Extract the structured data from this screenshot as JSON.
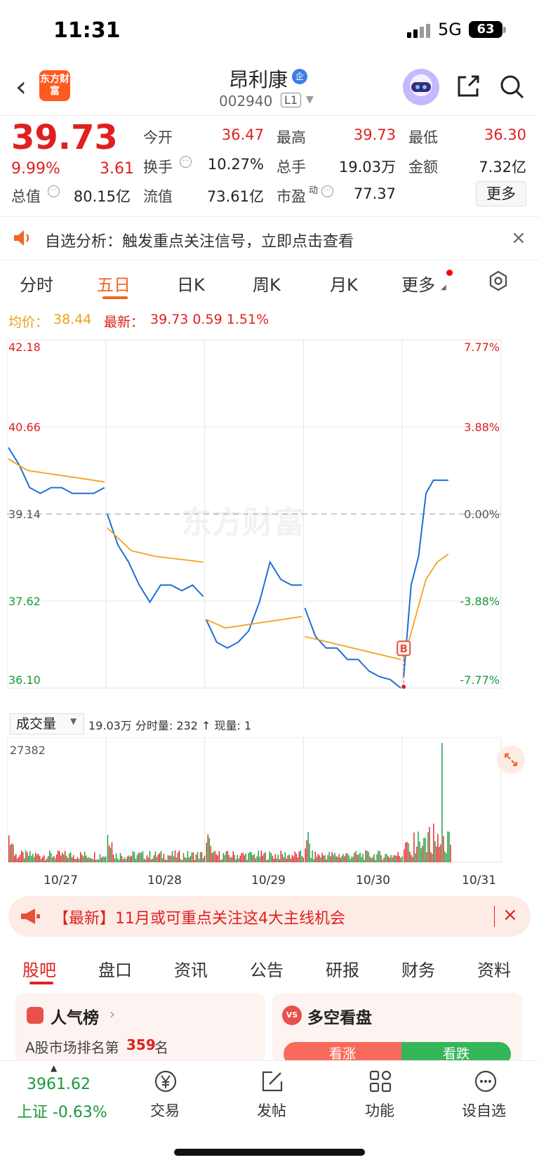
{
  "status_bar": {
    "time": "11:31",
    "network": "5G",
    "battery": "63"
  },
  "header": {
    "name": "昂利康",
    "name_badge": "企",
    "code": "002940",
    "market_tag": "L1",
    "logo_text": "东方财富"
  },
  "quote": {
    "price": "39.73",
    "change_pct": "9.99%",
    "change": "3.61",
    "fields": [
      {
        "label": "今开",
        "value": "36.47",
        "color": "red"
      },
      {
        "label": "最高",
        "value": "39.73",
        "color": "red"
      },
      {
        "label": "最低",
        "value": "36.30",
        "color": "red"
      },
      {
        "label": "换手",
        "value": "10.27%",
        "color": "dark"
      },
      {
        "label": "总手",
        "value": "19.03万",
        "color": "dark"
      },
      {
        "label": "金额",
        "value": "7.32亿",
        "color": "dark"
      },
      {
        "label": "总值",
        "value": "80.15亿",
        "color": "dark"
      },
      {
        "label": "流值",
        "value": "73.61亿",
        "color": "dark"
      },
      {
        "label": "市盈",
        "label_sup": "动",
        "value": "77.37",
        "color": "dark"
      }
    ],
    "more_label": "更多"
  },
  "alert": {
    "text": "自选分析：触发重点关注信号，立即点击查看",
    "close": "×"
  },
  "chart_tabs": [
    "分时",
    "五日",
    "日K",
    "周K",
    "月K",
    "更多"
  ],
  "active_chart_tab": "五日",
  "legend": {
    "avg_label": "均价：",
    "avg_value": "38.44",
    "latest_label": "最新：",
    "latest_value": "39.73  0.59  1.51%"
  },
  "watermark": "东方财富",
  "buy_marker": "B",
  "chart_data": {
    "type": "line",
    "x": [
      "10/27",
      "10/28",
      "10/29",
      "10/30",
      "10/31"
    ],
    "y_ticks_left": [
      "42.18",
      "40.66",
      "39.14",
      "37.62",
      "36.10"
    ],
    "y_ticks_right": [
      "7.77%",
      "3.88%",
      "0.00%",
      "-3.88%",
      "-7.77%"
    ],
    "ylim": [
      36.1,
      42.18
    ],
    "prev_close": 39.14,
    "series": [
      {
        "name": "",
        "color": "#1e6fd6",
        "values": [
          [
            40.3,
            40.0,
            39.6,
            39.5,
            39.6,
            39.6,
            39.5,
            39.5,
            39.5,
            39.6
          ],
          [
            39.14,
            38.6,
            38.3,
            37.9,
            37.6,
            37.9,
            37.9,
            37.8,
            37.9,
            37.7
          ],
          [
            37.3,
            36.9,
            36.8,
            36.9,
            37.1,
            37.6,
            38.3,
            38.0,
            37.9,
            37.9
          ],
          [
            37.5,
            37.0,
            36.8,
            36.8,
            36.6,
            36.6,
            36.4,
            36.3,
            36.25,
            36.1
          ],
          [
            36.3,
            37.9,
            38.4,
            39.5,
            39.73,
            39.73,
            39.73
          ]
        ]
      },
      {
        "name": "",
        "color": "#f2a41e",
        "values": [
          [
            40.1,
            39.9,
            39.85,
            39.8,
            39.75,
            39.7
          ],
          [
            38.9,
            38.5,
            38.4,
            38.35,
            38.3
          ],
          [
            37.3,
            37.15,
            37.2,
            37.25,
            37.3,
            37.35
          ],
          [
            37.0,
            36.9,
            36.8,
            36.7,
            36.6
          ],
          [
            36.6,
            37.3,
            38.0,
            38.3,
            38.44
          ]
        ]
      }
    ]
  },
  "volume": {
    "selector": "成交量",
    "info": "19.03万 分时量: 232 ↑ 现量: 1",
    "info_last": "1",
    "max_label": "27382"
  },
  "news": {
    "text": "【最新】11月或可重点关注这4大主线机会",
    "close": "×"
  },
  "content_tabs": [
    "股吧",
    "盘口",
    "资讯",
    "公告",
    "研报",
    "财务",
    "资料"
  ],
  "active_content_tab": "股吧",
  "cards": {
    "popularity": {
      "title": "人气榜",
      "caret": "›",
      "sub": "A股市场排名第",
      "rank": "359",
      "unit": "名"
    },
    "sentiment": {
      "icon": "VS",
      "title": "多空看盘",
      "bull": "看涨",
      "bear": "看跌"
    }
  },
  "bottom_nav": {
    "index_value": "3961.62",
    "index_label": "上证 -0.63%",
    "items": [
      {
        "label": "交易",
        "icon": "yen-coin-icon"
      },
      {
        "label": "发帖",
        "icon": "compose-icon"
      },
      {
        "label": "功能",
        "icon": "grid-icon"
      },
      {
        "label": "设自选",
        "icon": "dots-bubble-icon"
      }
    ]
  },
  "colors": {
    "red": "#e02020",
    "green": "#1a9a3a",
    "orange": "#f26522",
    "avg_line": "#f2a41e",
    "price_line": "#1e6fd6"
  }
}
